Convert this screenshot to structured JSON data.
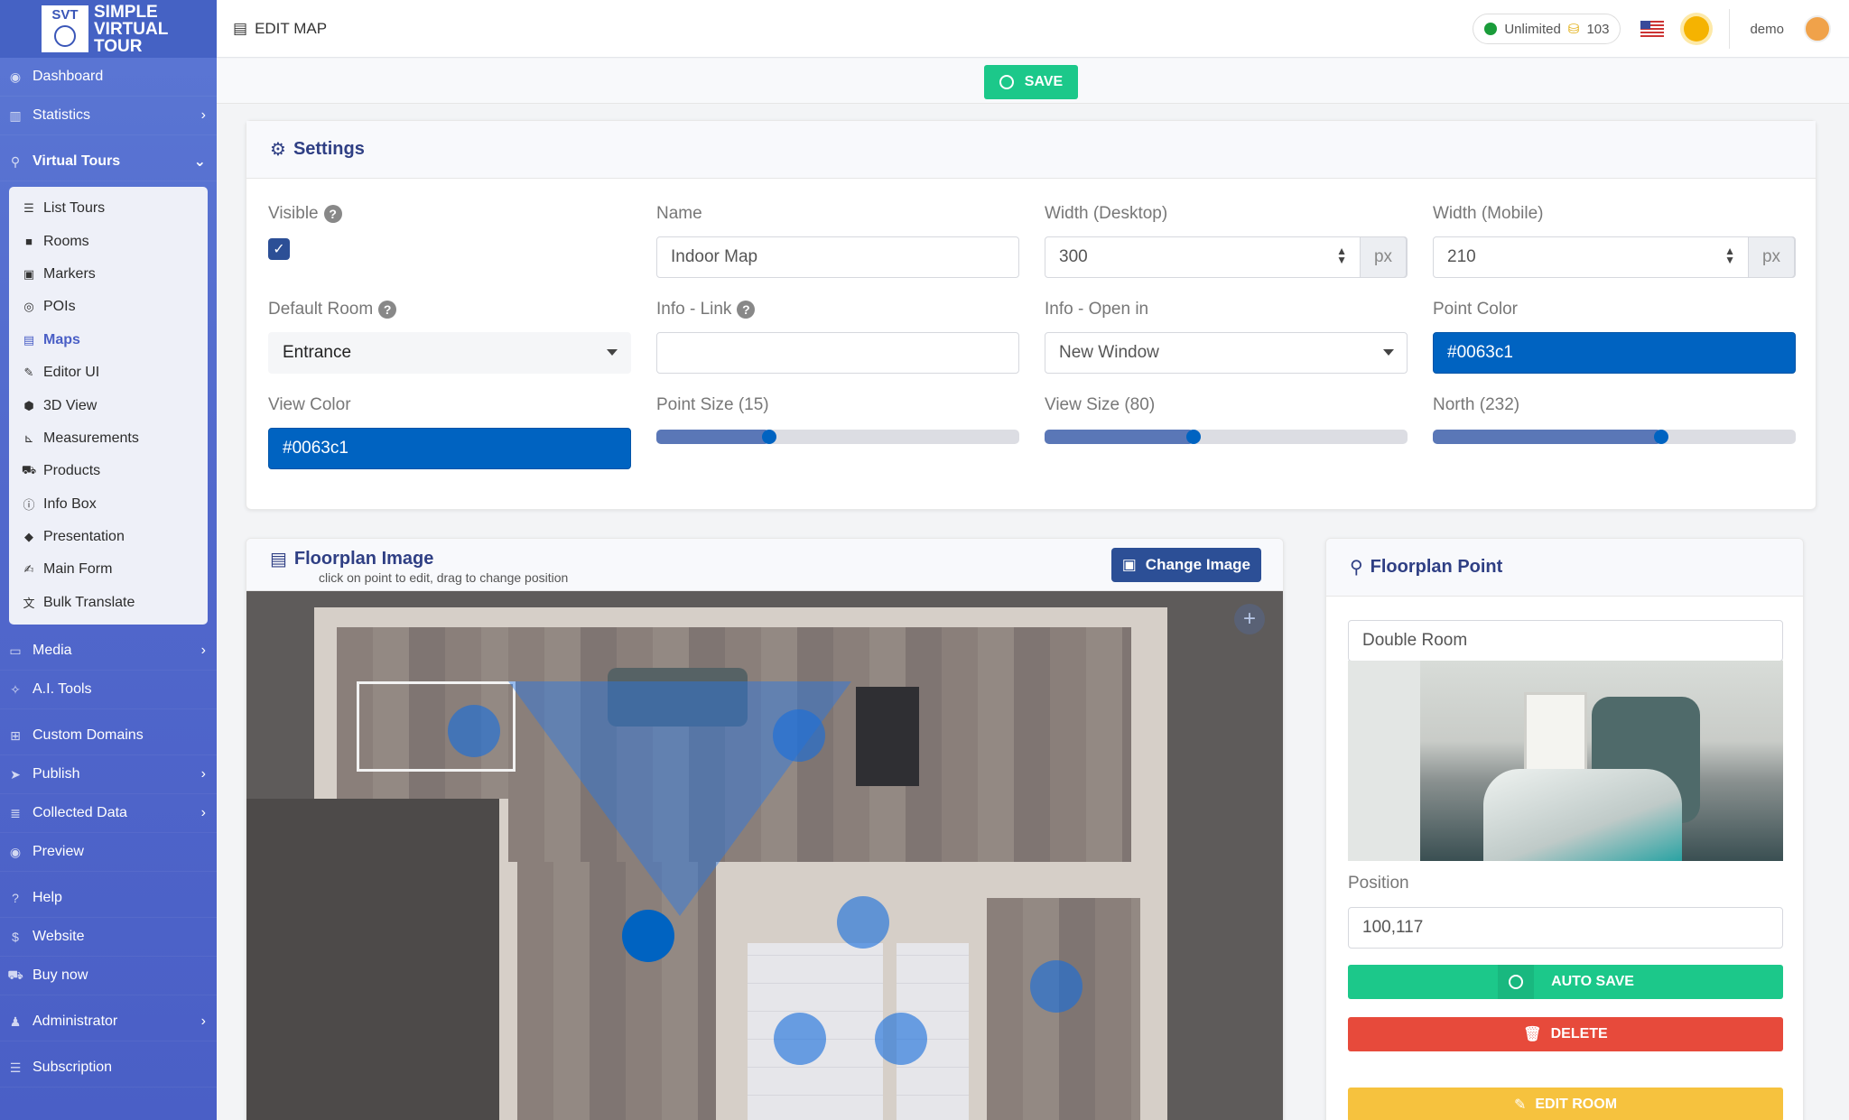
{
  "sidebar": {
    "logo": {
      "badge": "SVT",
      "line1": "SIMPLE",
      "line2": "VIRTUAL",
      "line3": "TOUR"
    },
    "top_items": [
      {
        "label": "Dashboard",
        "icon": "gauge-icon"
      },
      {
        "label": "Statistics",
        "icon": "chart-icon",
        "has_children": true
      }
    ],
    "virtual_tours": {
      "label": "Virtual Tours",
      "icon": "route-icon",
      "expanded": true
    },
    "sub_items": [
      {
        "label": "List Tours",
        "icon": "list-icon"
      },
      {
        "label": "Rooms",
        "icon": "square-icon"
      },
      {
        "label": "Markers",
        "icon": "image-icon"
      },
      {
        "label": "POIs",
        "icon": "target-icon"
      },
      {
        "label": "Maps",
        "icon": "map-icon",
        "active": true
      },
      {
        "label": "Editor UI",
        "icon": "editor-icon"
      },
      {
        "label": "3D View",
        "icon": "cube-icon"
      },
      {
        "label": "Measurements",
        "icon": "ruler-icon"
      },
      {
        "label": "Products",
        "icon": "cart-icon"
      },
      {
        "label": "Info Box",
        "icon": "info-icon"
      },
      {
        "label": "Presentation",
        "icon": "presentation-icon"
      },
      {
        "label": "Main Form",
        "icon": "form-icon"
      },
      {
        "label": "Bulk Translate",
        "icon": "translate-icon"
      }
    ],
    "bottom_items": [
      {
        "label": "Media",
        "icon": "monitor-icon",
        "has_children": true
      },
      {
        "label": "A.I. Tools",
        "icon": "sparkle-icon"
      },
      {
        "label": "Custom Domains",
        "icon": "sitemap-icon"
      },
      {
        "label": "Publish",
        "icon": "send-icon",
        "has_children": true
      },
      {
        "label": "Collected Data",
        "icon": "database-icon",
        "has_children": true
      },
      {
        "label": "Preview",
        "icon": "eye-icon"
      },
      {
        "label": "Help",
        "icon": "question-icon"
      },
      {
        "label": "Website",
        "icon": "dollar-icon"
      },
      {
        "label": "Buy now",
        "icon": "cart-icon"
      },
      {
        "label": "Administrator",
        "icon": "user-icon",
        "has_children": true
      },
      {
        "label": "Subscription",
        "icon": "layers-icon"
      }
    ]
  },
  "topbar": {
    "title": "EDIT MAP",
    "plan": "Unlimited",
    "credits": "103",
    "user": "demo"
  },
  "save_label": "SAVE",
  "settings": {
    "title": "Settings",
    "visible_label": "Visible",
    "visible_checked": true,
    "name_label": "Name",
    "name_value": "Indoor Map",
    "width_desktop_label": "Width (Desktop)",
    "width_desktop_value": "300",
    "width_mobile_label": "Width (Mobile)",
    "width_mobile_value": "210",
    "unit": "px",
    "default_room_label": "Default Room",
    "default_room_value": "Entrance",
    "info_link_label": "Info - Link",
    "info_link_value": "",
    "info_open_label": "Info - Open in",
    "info_open_value": "New Window",
    "point_color_label": "Point Color",
    "point_color_value": "#0063c1",
    "view_color_label": "View Color",
    "view_color_value": "#0063c1",
    "point_size_label": "Point Size (15)",
    "point_size_fraction": 0.31,
    "view_size_label": "View Size (80)",
    "view_size_fraction": 0.41,
    "north_label": "North (232)",
    "north_fraction": 0.63
  },
  "floorplan": {
    "title": "Floorplan Image",
    "subtitle": "click on point to edit, drag to change position",
    "change_label": "Change Image"
  },
  "floor_point": {
    "title": "Floorplan Point",
    "room_name": "Double Room",
    "position_label": "Position",
    "position_value": "100,117",
    "auto_save_label": "AUTO SAVE",
    "delete_label": "DELETE",
    "edit_room_label": "EDIT ROOM"
  },
  "colors": {
    "primary": "#4a5fc6",
    "accent": "#0063c1",
    "success": "#1cc88a",
    "danger": "#e74a3b",
    "warning": "#f6c23e"
  }
}
